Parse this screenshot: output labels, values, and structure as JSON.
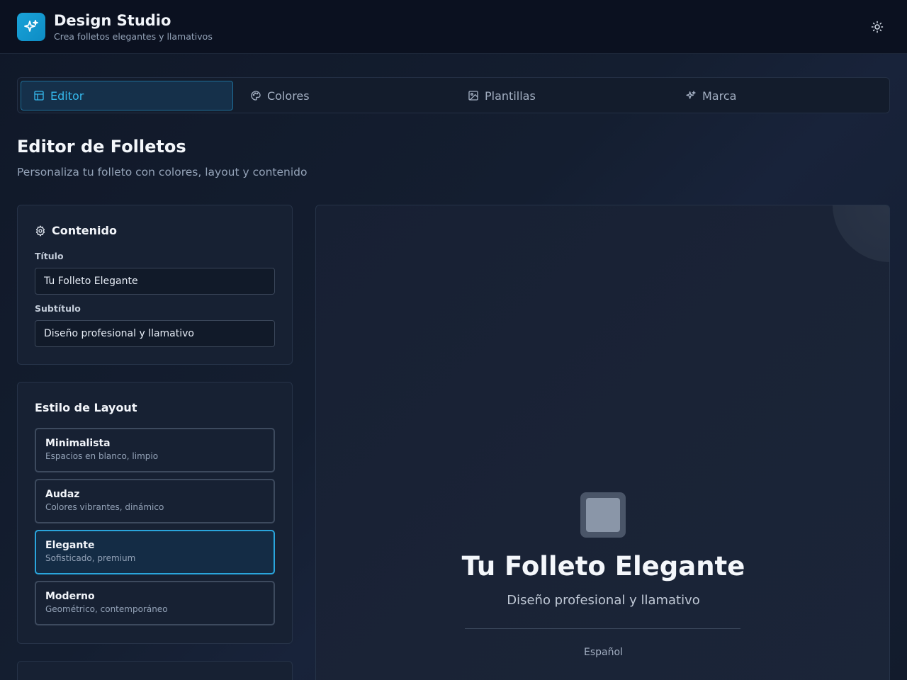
{
  "app": {
    "title": "Design Studio",
    "subtitle": "Crea folletos elegantes y llamativos",
    "logo_icon": "sparkles-icon",
    "theme_toggle_icon": "sun-icon"
  },
  "tabs": [
    {
      "label": "Editor",
      "icon": "layout-icon",
      "active": true
    },
    {
      "label": "Colores",
      "icon": "palette-icon",
      "active": false
    },
    {
      "label": "Plantillas",
      "icon": "image-icon",
      "active": false
    },
    {
      "label": "Marca",
      "icon": "sparkles-icon",
      "active": false
    }
  ],
  "page": {
    "title": "Editor de Folletos",
    "subtitle": "Personaliza tu folleto con colores, layout y contenido"
  },
  "content_card": {
    "title": "Contenido",
    "title_icon": "gear-icon",
    "title_field_label": "Título",
    "title_field_value": "Tu Folleto Elegante",
    "subtitle_field_label": "Subtítulo",
    "subtitle_field_value": "Diseño profesional y llamativo"
  },
  "layout_card": {
    "title": "Estilo de Layout",
    "options": [
      {
        "name": "Minimalista",
        "description": "Espacios en blanco, limpio",
        "selected": false
      },
      {
        "name": "Audaz",
        "description": "Colores vibrantes, dinámico",
        "selected": false
      },
      {
        "name": "Elegante",
        "description": "Sofisticado, premium",
        "selected": true
      },
      {
        "name": "Moderno",
        "description": "Geométrico, contemporáneo",
        "selected": false
      }
    ]
  },
  "preview": {
    "title": "Tu Folleto Elegante",
    "subtitle": "Diseño profesional y llamativo",
    "language": "Español"
  },
  "colors": {
    "accent": "#2aa5dc",
    "background": "#111a2b",
    "card": "#172133"
  }
}
